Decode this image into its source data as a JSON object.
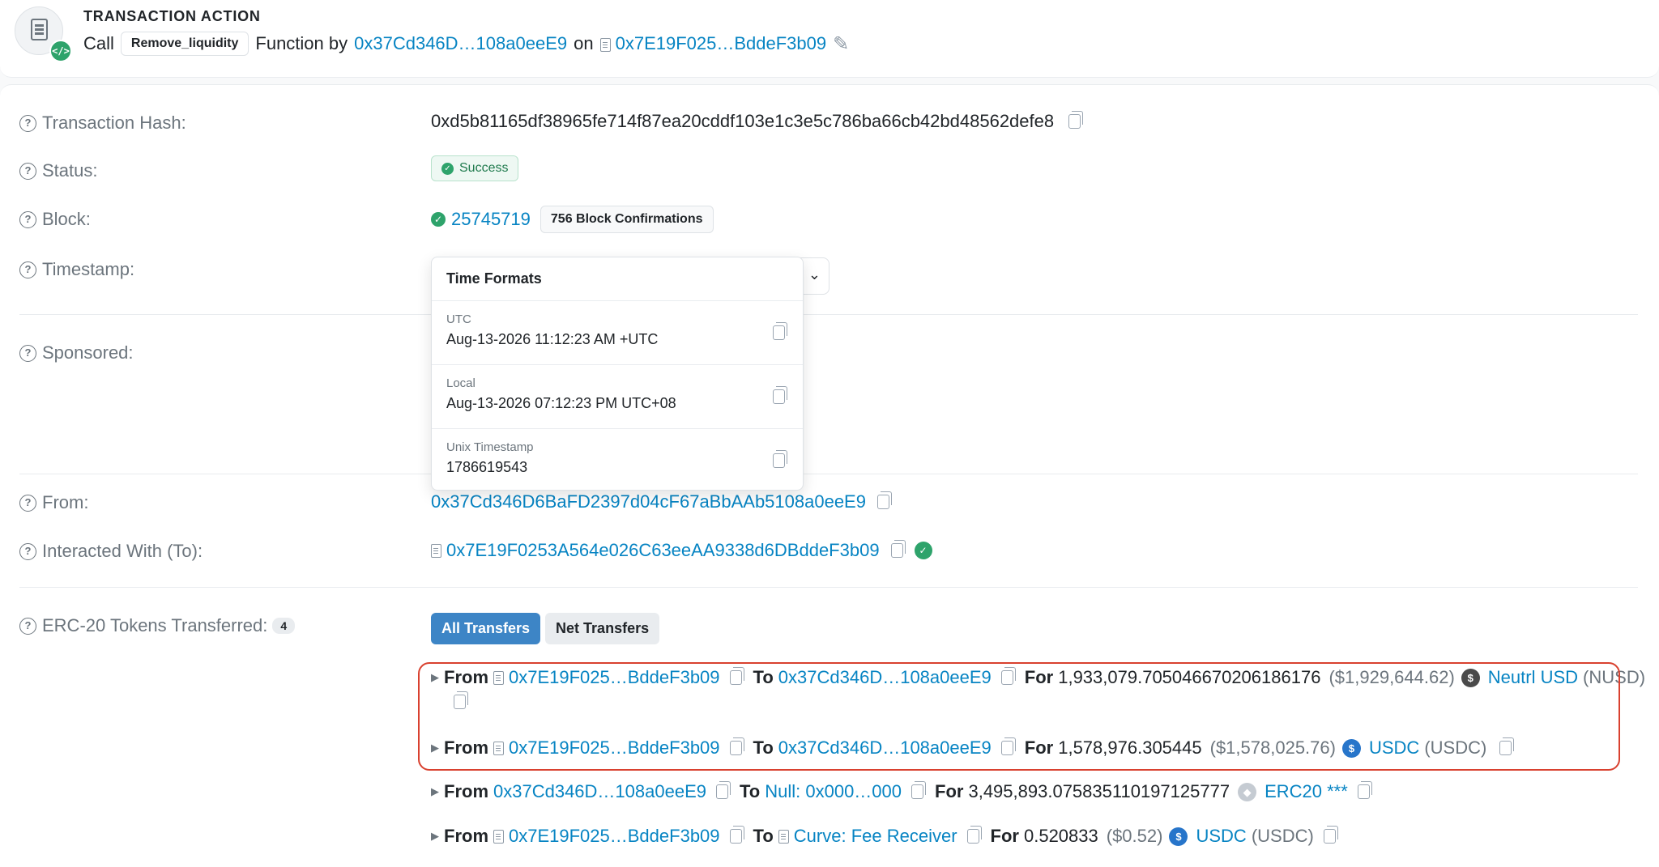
{
  "header": {
    "title": "TRANSACTION ACTION",
    "call_word": "Call",
    "function_name": "Remove_liquidity",
    "function_by": "Function by",
    "from_addr_short": "0x37Cd346D…108a0eeE9",
    "on_word": "on",
    "contract_short": "0x7E19F025…BddeF3b09"
  },
  "details": {
    "tx_hash_label": "Transaction Hash:",
    "tx_hash": "0xd5b81165df38965fe714f87ea20cddf103e1c3e5c786ba66cb42bd48562defe8",
    "status_label": "Status:",
    "status": "Success",
    "block_label": "Block:",
    "block": "25745719",
    "confirmations": "756 Block Confirmations",
    "timestamp_label": "Timestamp:",
    "sponsored_label": "Sponsored:",
    "from_label": "From:",
    "from": "0x37Cd346D6BaFD2397d04cF67aBbAAb5108a0eeE9",
    "to_label": "Interacted With (To):",
    "to": "0x7E19F0253A564e026C63eeAA9338d6DBddeF3b09"
  },
  "time_formats": {
    "title": "Time Formats",
    "items": [
      {
        "label": "UTC",
        "value": "Aug-13-2026 11:12:23 AM +UTC"
      },
      {
        "label": "Local",
        "value": "Aug-13-2026 07:12:23 PM UTC+08"
      },
      {
        "label": "Unix Timestamp",
        "value": "1786619543"
      }
    ]
  },
  "erc20": {
    "label": "ERC-20 Tokens Transferred:",
    "count": "4",
    "tab_all": "All Transfers",
    "tab_net": "Net Transfers",
    "from_word": "From",
    "to_word": "To",
    "for_word": "For",
    "transfers": [
      {
        "from": "0x7E19F025…BddeF3b09",
        "to": "0x37Cd346D…108a0eeE9",
        "amount": "1,933,079.705046670206186176",
        "usd": "($1,929,644.62)",
        "token": "Neutrl USD",
        "symbol": "(NUSD)"
      },
      {
        "from": "0x7E19F025…BddeF3b09",
        "to": "0x37Cd346D…108a0eeE9",
        "amount": "1,578,976.305445",
        "usd": "($1,578,025.76)",
        "token": "USDC",
        "symbol": "(USDC)"
      },
      {
        "from": "0x37Cd346D…108a0eeE9",
        "to": "Null: 0x000…000",
        "amount": "3,495,893.075835110197125777",
        "usd": "",
        "token": "ERC20 ***",
        "symbol": ""
      },
      {
        "from": "0x7E19F025…BddeF3b09",
        "to": "Curve: Fee Receiver",
        "amount": "0.520833",
        "usd": "($0.52)",
        "token": "USDC",
        "symbol": "(USDC)"
      }
    ]
  },
  "colors": {
    "link": "#0784c3",
    "success": "#2ea36b",
    "highlight": "#d9412f",
    "tab_active": "#3d85c6"
  }
}
